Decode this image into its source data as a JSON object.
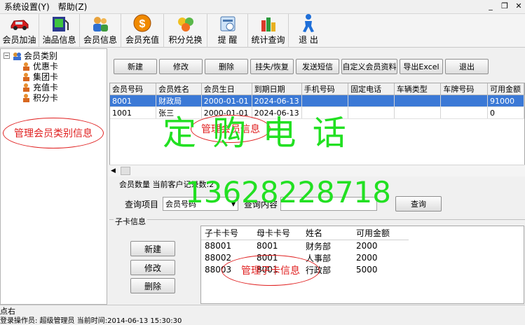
{
  "menubar": {
    "items": [
      "系统设置(Y)",
      "帮助(Z)"
    ]
  },
  "window_controls": {
    "minimize": "_",
    "restore": "❐",
    "close": "✕"
  },
  "toolbar": {
    "buttons": [
      "会员加油",
      "油品信息",
      "会员信息",
      "会员充值",
      "积分兑换",
      "提 醒",
      "统计查询",
      "退 出"
    ]
  },
  "tree": {
    "root": "会员类别",
    "items": [
      "优惠卡",
      "集团卡",
      "充值卡",
      "积分卡"
    ]
  },
  "annotations": {
    "left": "管理会员类别信息",
    "main": "管理会员信息",
    "sub": "管理子卡信息"
  },
  "watermark": {
    "line1": "定 购 电 话",
    "line2": "13628228718"
  },
  "actions": {
    "buttons": [
      "新建",
      "修改",
      "删除",
      "挂失/恢复",
      "发送短信",
      "自定义会员资料",
      "导出Excel",
      "退出"
    ]
  },
  "member_grid": {
    "columns": [
      "会员号码",
      "会员姓名",
      "会员生日",
      "到期日期",
      "手机号码",
      "固定电话",
      "车辆类型",
      "车牌号码",
      "可用金额"
    ],
    "rows": [
      [
        "8001",
        "财政局",
        "2000-01-01",
        "2024-06-13",
        "",
        "",
        "",
        "",
        "91000"
      ],
      [
        "1001",
        "张三",
        "2000-01-01",
        "2024-06-13",
        "",
        "",
        "",
        "",
        "0"
      ]
    ]
  },
  "status_info": "会员数量  当前客户记录数:2",
  "query": {
    "label": "查询项目",
    "selected": "会员号码",
    "content_label": "查询内容",
    "input_value": "",
    "button": "查询"
  },
  "subcard": {
    "title": "子卡信息",
    "buttons": [
      "新建",
      "修改",
      "删除"
    ],
    "columns": [
      "子卡卡号",
      "母卡卡号",
      "姓名",
      "可用金额"
    ],
    "rows": [
      [
        "88001",
        "8001",
        "财务部",
        "2000"
      ],
      [
        "88002",
        "8001",
        "人事部",
        "2000"
      ],
      [
        "88003",
        "8001",
        "行政部",
        "5000"
      ]
    ]
  },
  "statusbar": {
    "left_hint": "点右",
    "bottom_text": "登录操作员: 超级管理员    当前时间:2014-06-13 15:30:30"
  },
  "colors": {
    "selection": "#3b79d6",
    "annotation": "#e02020",
    "watermark": "#22e022"
  }
}
